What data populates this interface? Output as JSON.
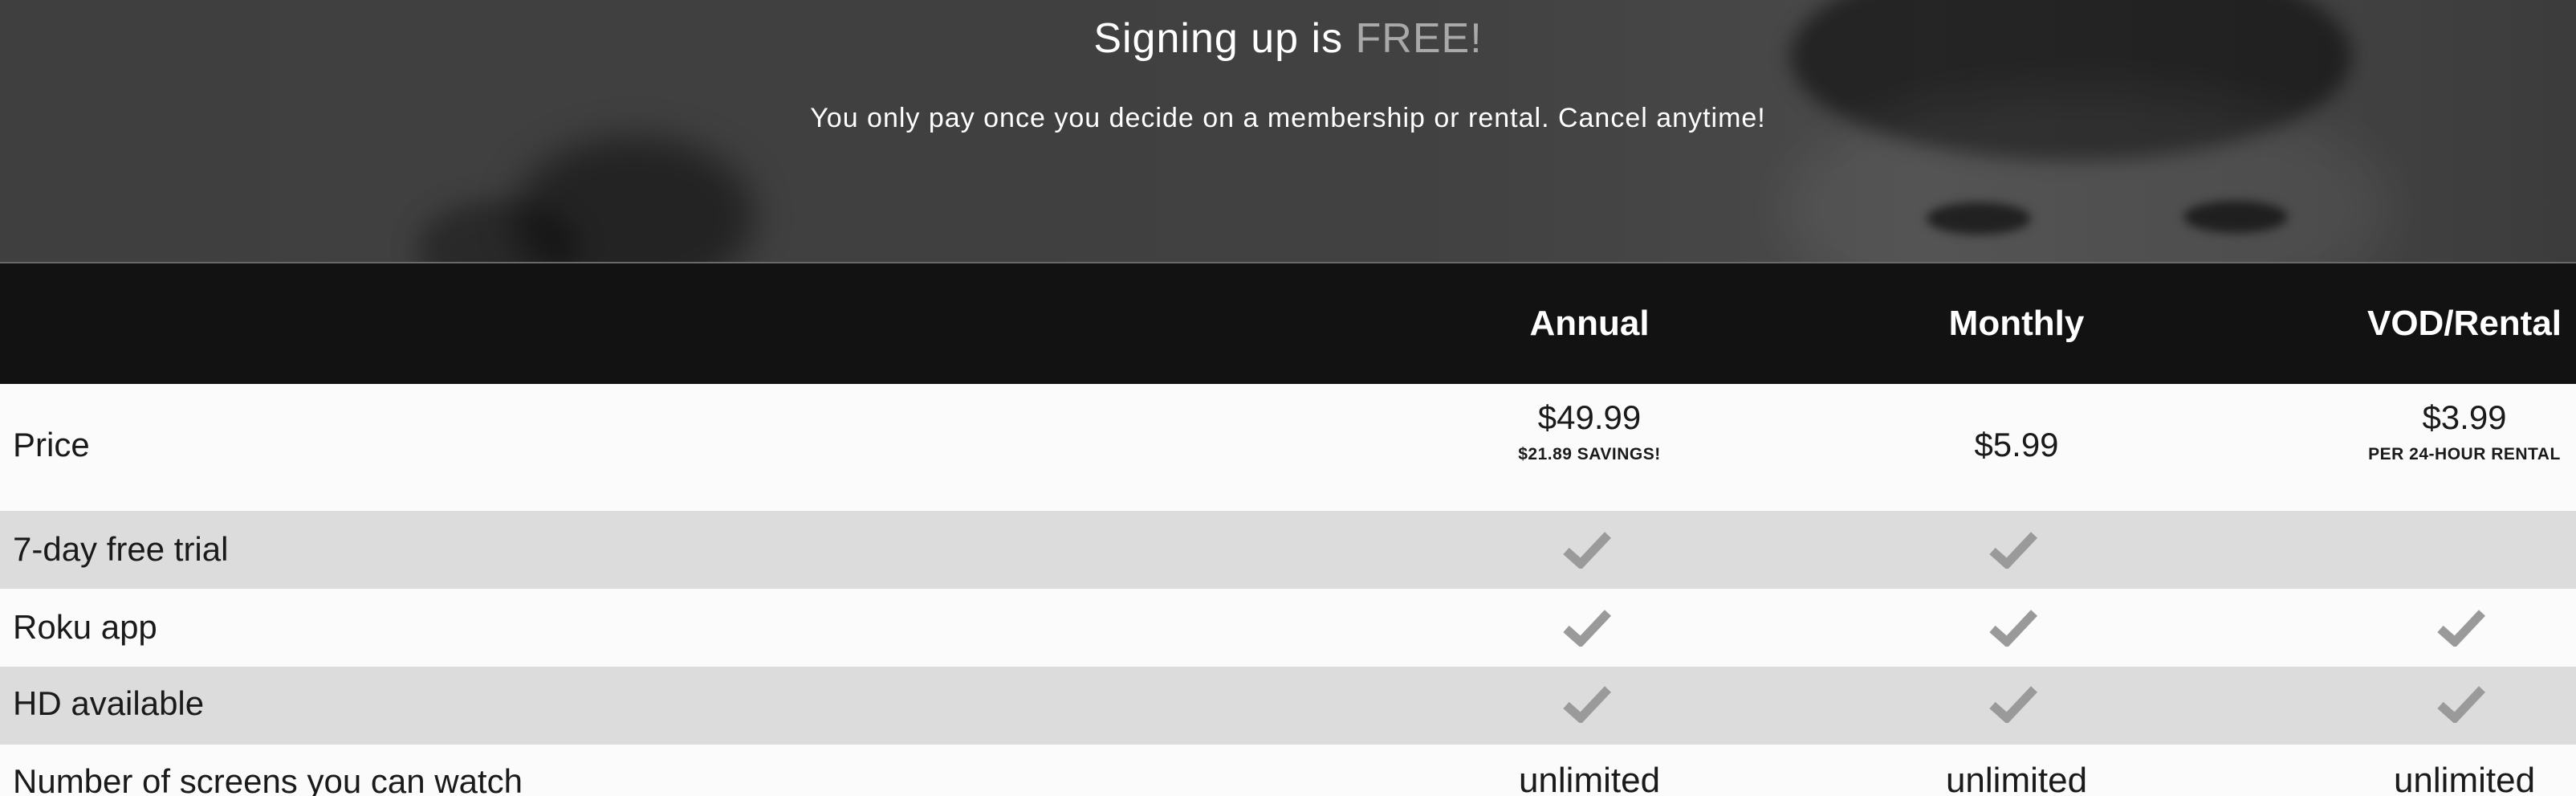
{
  "hero": {
    "title_prefix": "Signing up is",
    "title_highlight": "FREE!",
    "subtitle": "You only pay once you decide on a membership or rental. Cancel anytime!"
  },
  "plans": [
    "Annual",
    "Monthly",
    "VOD/Rental"
  ],
  "rows": {
    "price": {
      "label": "Price",
      "annual": "$49.99",
      "annual_note": "$21.89 SAVINGS!",
      "monthly": "$5.99",
      "vod": "$3.99",
      "vod_note": "PER 24-HOUR RENTAL"
    },
    "trial": {
      "label": "7-day free trial",
      "annual": true,
      "monthly": true,
      "vod": false
    },
    "roku": {
      "label": "Roku app",
      "annual": true,
      "monthly": true,
      "vod": true
    },
    "hd": {
      "label": "HD available",
      "annual": true,
      "monthly": true,
      "vod": true
    },
    "screens": {
      "label": "Number of screens you can watch",
      "annual": "unlimited",
      "monthly": "unlimited",
      "vod": "unlimited"
    }
  },
  "icons": {
    "check": "check-icon"
  },
  "colors": {
    "header_bg": "#121212",
    "row_alt_bg": "#dcdcdc",
    "check": "#9a9a9a",
    "free_highlight": "#a9a9a9"
  }
}
